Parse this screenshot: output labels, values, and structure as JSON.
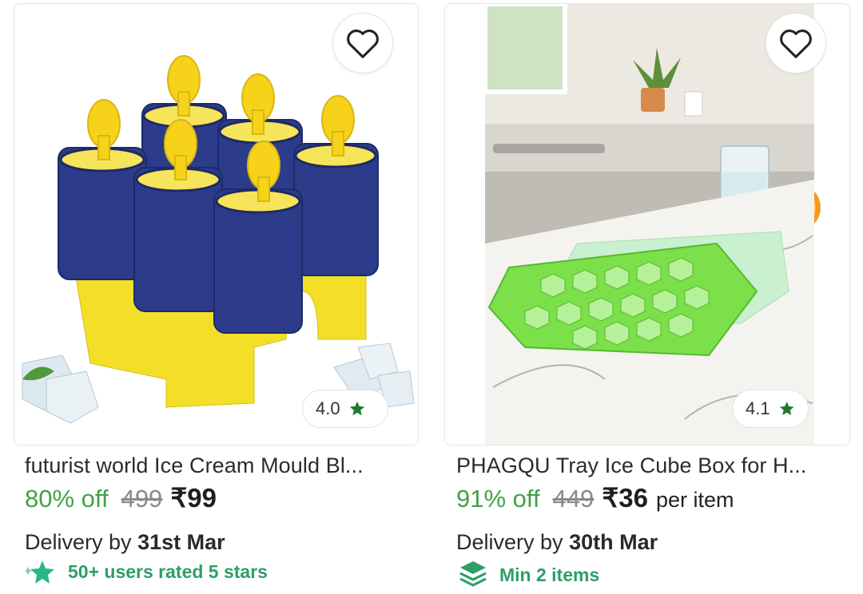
{
  "products": [
    {
      "title": "futurist world Ice Cream Mould Bl...",
      "rating": "4.0",
      "discount": "80% off",
      "mrp": "499",
      "price": "₹99",
      "unit": "",
      "delivery_label": "Delivery by",
      "delivery_date": "31st Mar",
      "badge": "50+ users rated 5 stars",
      "badge_icon": "sparkle-star-icon",
      "image": "popsicle-mould-photo",
      "colors": {
        "mould_blue": "#2c3c8a",
        "mould_yellow": "#f6e22a"
      }
    },
    {
      "title": "PHAGQU Tray Ice Cube Box for H...",
      "rating": "4.1",
      "discount": "91% off",
      "mrp": "449",
      "price": "₹36",
      "unit": "per item",
      "delivery_label": "Delivery by",
      "delivery_date": "30th Mar",
      "badge": "Min 2 items",
      "badge_icon": "layers-stack-icon",
      "image": "ice-cube-tray-kitchen-photo",
      "colors": {
        "tray_green": "#7be04a"
      }
    }
  ],
  "colors": {
    "discount_green": "#43a047",
    "rating_star": "#1f7a2e",
    "badge_teal": "#2e9e69"
  }
}
